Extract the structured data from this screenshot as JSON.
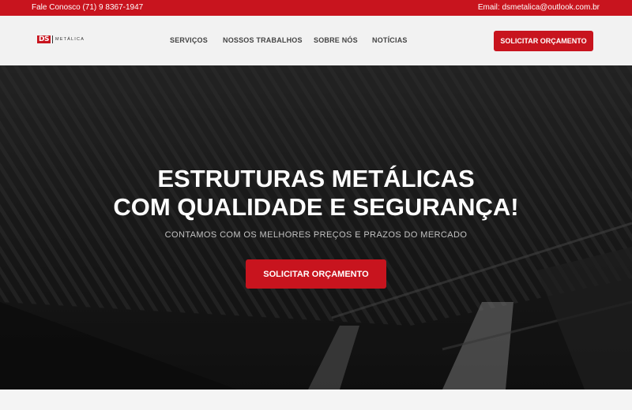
{
  "topbar": {
    "phone": "Fale Conosco (71) 9 8367-1947",
    "email": "Email: dsmetalica@outlook.com.br"
  },
  "logo": {
    "mark": "DS",
    "text": "METÁLICA"
  },
  "nav": {
    "items": [
      {
        "label": "SERVIÇOS"
      },
      {
        "label": "NOSSOS TRABALHOS"
      },
      {
        "label": "SOBRE NÓS"
      },
      {
        "label": "NOTÍCIAS"
      }
    ],
    "cta_label": "SOLICITAR ORÇAMENTO"
  },
  "hero": {
    "title_line1": "ESTRUTURAS METÁLICAS",
    "title_line2": "COM QUALIDADE E SEGURANÇA!",
    "subtitle": "CONTAMOS COM OS MELHORES PREÇOS E PRAZOS DO MERCADO",
    "cta_label": "SOLICITAR ORÇAMENTO"
  },
  "colors": {
    "brand_red": "#c8141e",
    "nav_bg": "#f2f2f2",
    "hero_overlay": "#1b1b1b"
  }
}
